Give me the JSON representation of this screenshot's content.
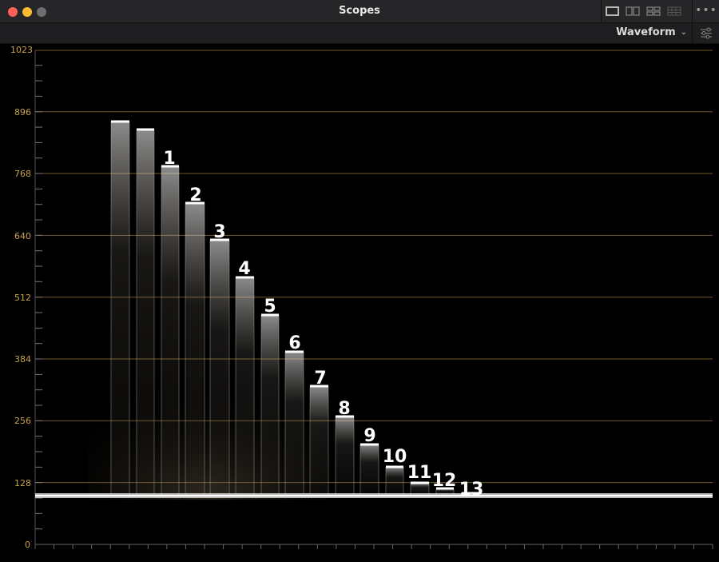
{
  "window": {
    "title": "Scopes"
  },
  "toolbar": {
    "scope_type": "Waveform",
    "more_label": "•••"
  },
  "axis": {
    "ticks": [
      "1023",
      "896",
      "768",
      "640",
      "512",
      "384",
      "256",
      "128",
      "0"
    ]
  },
  "steps": {
    "labels": [
      "1",
      "2",
      "3",
      "4",
      "5",
      "6",
      "7",
      "8",
      "9",
      "10",
      "11",
      "12",
      "13"
    ]
  },
  "colors": {
    "grid": "#c9a34a",
    "trace": "#ffffff",
    "background": "#000000"
  }
}
